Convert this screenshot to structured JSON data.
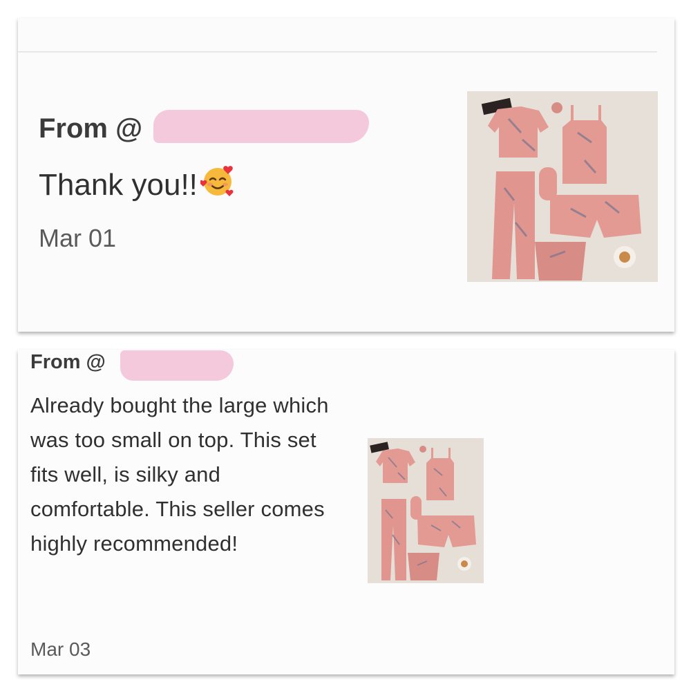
{
  "reviews": [
    {
      "from_label": "From @",
      "message": "Thank you!!",
      "emoji": "smiling-face-with-hearts-icon",
      "date": "Mar 01",
      "product_image": "pink-satin-pajama-set-image"
    },
    {
      "from_label": "From @",
      "message": "Already bought the large which was too small on top. This set fits well, is silky and comfortable. This seller comes highly recommended!",
      "date": "Mar 03",
      "product_image": "pink-satin-pajama-set-image"
    }
  ],
  "colors": {
    "redaction": "#f4c9db",
    "pajama_pink": "#e39a93",
    "photo_background": "#e6dfd8"
  }
}
